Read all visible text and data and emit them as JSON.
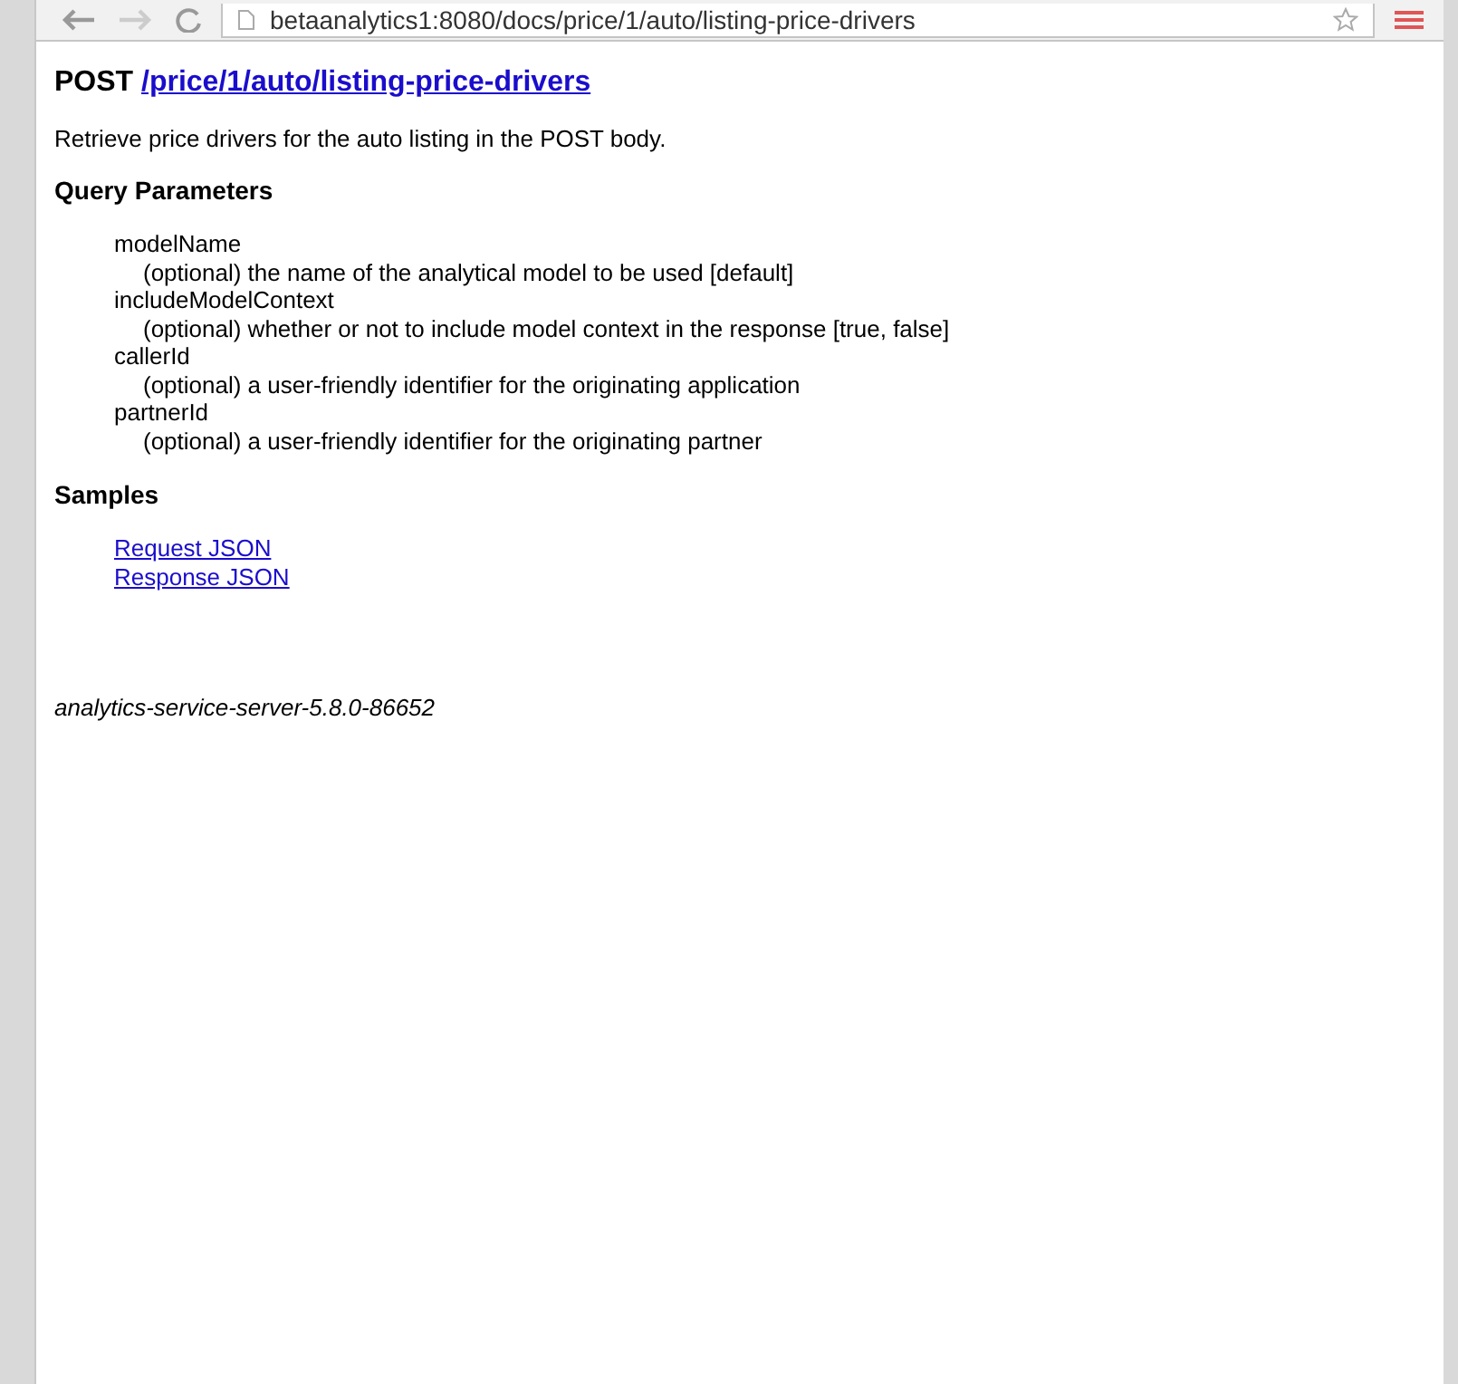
{
  "browser": {
    "url": "betaanalytics1:8080/docs/price/1/auto/listing-price-drivers"
  },
  "endpoint": {
    "method": "POST",
    "path": "/price/1/auto/listing-price-drivers"
  },
  "description": "Retrieve price drivers for the auto listing in the POST body.",
  "query_parameters": {
    "heading": "Query Parameters",
    "items": [
      {
        "name": "modelName",
        "detail": "(optional) the name of the analytical model to be used [default]"
      },
      {
        "name": "includeModelContext",
        "detail": "(optional) whether or not to include model context in the response [true, false]"
      },
      {
        "name": "callerId",
        "detail": "(optional) a user-friendly identifier for the originating application"
      },
      {
        "name": "partnerId",
        "detail": "(optional) a user-friendly identifier for the originating partner"
      }
    ]
  },
  "samples": {
    "heading": "Samples",
    "links": [
      "Request JSON",
      "Response JSON"
    ]
  },
  "footer": "analytics-service-server-5.8.0-86652"
}
